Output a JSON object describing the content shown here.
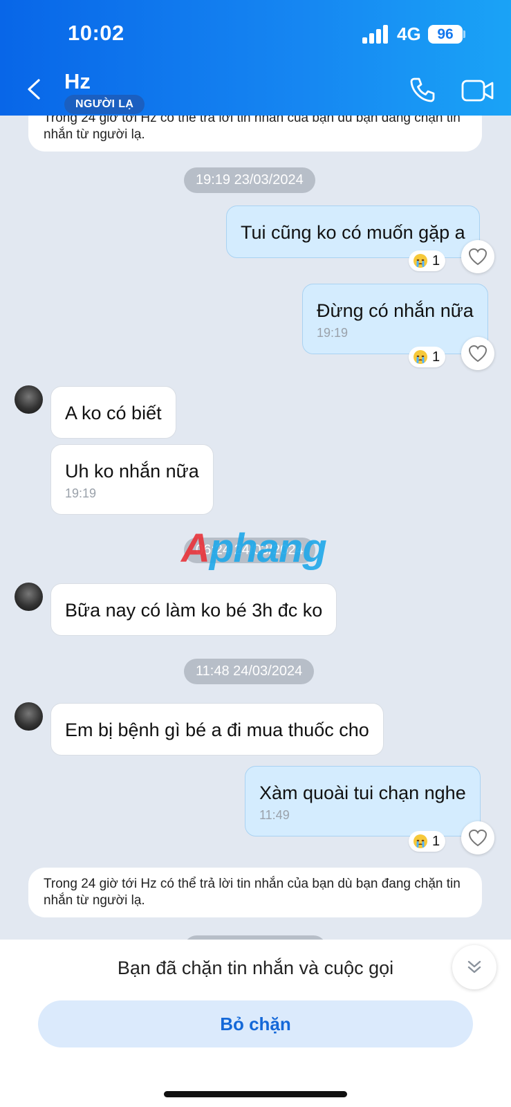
{
  "status_bar": {
    "time": "10:02",
    "network": "4G",
    "battery": "96"
  },
  "header": {
    "name": "Hz",
    "badge": "NGƯỜI LẠ"
  },
  "notices": {
    "top": "Trong 24 giờ tới Hz có thể trả lời tin nhắn của bạn dù bạn đang chặn tin nhắn từ người lạ.",
    "bottom": "Trong 24 giờ tới Hz có thể trả lời tin nhắn của bạn dù bạn đang chặn tin nhắn từ người lạ."
  },
  "time_chips": [
    "19:19 23/03/2024",
    "06:24 24/03/2024",
    "11:48 24/03/2024"
  ],
  "messages": [
    {
      "dir": "out",
      "text": "Tui cũng ko có muốn gặp a",
      "reaction_count": "1"
    },
    {
      "dir": "out",
      "text": "Đừng có nhắn nữa",
      "time": "19:19",
      "reaction_count": "1"
    },
    {
      "dir": "in",
      "text": "A ko có biết"
    },
    {
      "dir": "in",
      "text": "Uh ko nhắn nữa",
      "time": "19:19"
    },
    {
      "dir": "in",
      "text": "Bữa nay có làm ko bé 3h đc ko"
    },
    {
      "dir": "in",
      "text": "Em bị bệnh gì bé a đi mua thuốc cho"
    },
    {
      "dir": "out",
      "text": "Xàm quoài tui chạn nghe",
      "time": "11:49",
      "reaction_count": "1"
    }
  ],
  "watermark": {
    "part1": "A",
    "part2": "phang"
  },
  "footer": {
    "blocked_text": "Bạn đã chặn tin nhắn và cuộc gọi",
    "unblock_label": "Bỏ chặn"
  },
  "icons": {
    "back": "chevron-left-icon",
    "call": "phone-icon",
    "video": "video-camera-icon",
    "heart": "heart-outline-icon",
    "reaction": "crying-face-emoji",
    "scroll": "double-chevron-down-icon"
  },
  "colors": {
    "header_start": "#0866e8",
    "header_end": "#1aa3f6",
    "outgoing_bubble": "#d4ecfe",
    "chat_bg": "#e2e8f1",
    "unblock_text": "#1468d8"
  }
}
